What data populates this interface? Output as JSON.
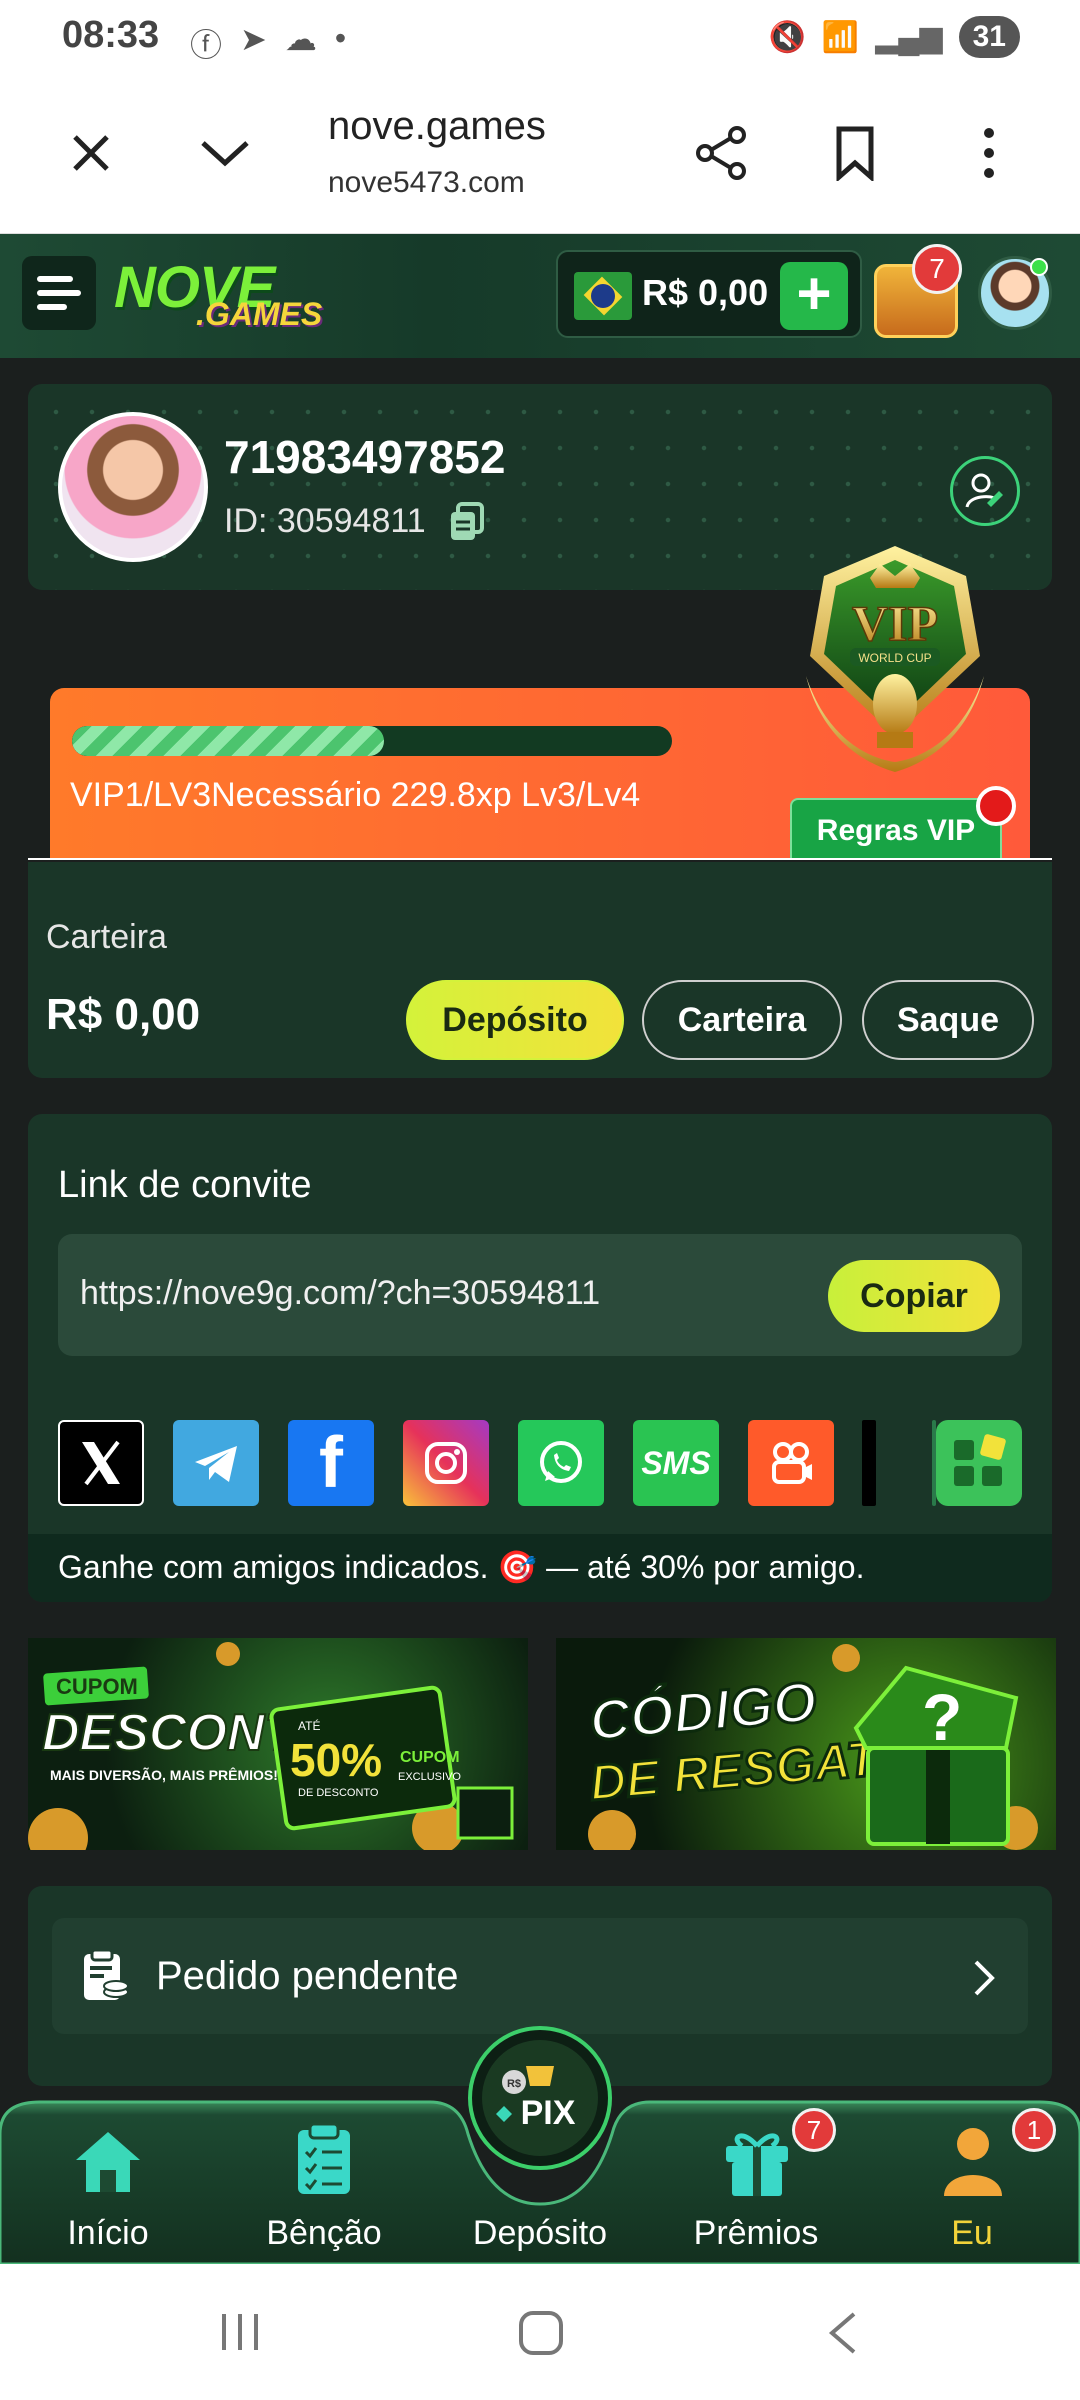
{
  "status_bar": {
    "time": "08:33",
    "battery": "31"
  },
  "browser": {
    "title": "nove.games",
    "url": "nove5473.com"
  },
  "header": {
    "logo_main": "NOVE",
    "logo_sub": ".GAMES",
    "balance": "R$ 0,00",
    "chest_badge": "7"
  },
  "profile": {
    "username": "71983497852",
    "id_text": "ID: 30594811"
  },
  "vip": {
    "progress_percent": 52,
    "status_text": "VIP1/LV3Necessário 229.8xp Lv3/Lv4",
    "rules_button": "Regras VIP",
    "badge_title": "VIP",
    "badge_sub": "WORLD CUP"
  },
  "wallet": {
    "label": "Carteira",
    "amount": "R$ 0,00",
    "deposit_button": "Depósito",
    "wallet_button": "Carteira",
    "withdraw_button": "Saque"
  },
  "invite": {
    "title": "Link de convite",
    "link": "https://nove9g.com/?ch=30594811",
    "copy_button": "Copiar",
    "share_targets": [
      "x-icon",
      "telegram-icon",
      "facebook-icon",
      "instagram-icon",
      "whatsapp-icon",
      "sms-icon",
      "kwai-icon",
      "more-apps-icon"
    ],
    "sms_label": "SMS",
    "footer": "Ganhe com amigos indicados. 🎯 — até 30% por amigo."
  },
  "banners": {
    "coupon": {
      "tag": "CUPOM",
      "title": "DESCONTO",
      "subtitle": "MAIS DIVERSÃO, MAIS PRÊMIOS!",
      "percent_label": "ATÉ",
      "percent": "50%",
      "percent_sub": "DE DESCONTO",
      "badge": "CUPOM",
      "badge_sub": "EXCLUSIVO"
    },
    "redeem": {
      "line1": "CÓDIGO",
      "line2": "DE RESGATE"
    }
  },
  "pending": {
    "label": "Pedido pendente"
  },
  "bottom_nav": {
    "items": [
      {
        "label": "Início"
      },
      {
        "label": "Bênção"
      },
      {
        "label": "Depósito"
      },
      {
        "label": "Prêmios",
        "badge": "7"
      },
      {
        "label": "Eu",
        "badge": "1"
      }
    ],
    "pix_label": "PIX",
    "pix_rs": "R$"
  },
  "colors": {
    "accent_green": "#7cf03a",
    "active_nav": "#f2d33a",
    "vip_orange": "#ff6a32"
  }
}
